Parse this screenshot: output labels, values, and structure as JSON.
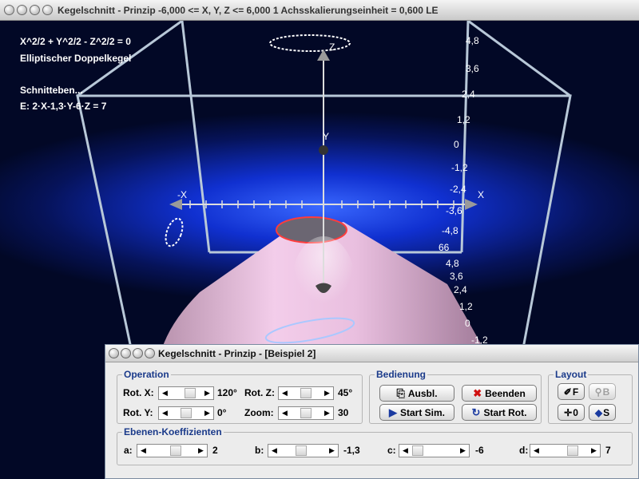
{
  "main_window": {
    "title": "Kegelschnitt - Prinzip   -6,000 <= X, Y, Z <= 6,000    1 Achsskalierungseinheit = 0,600 LE"
  },
  "scene": {
    "equation": "X^2/2 + Y^2/2 - Z^2/2 = 0",
    "shape_name": "Elliptischer Doppelkegel",
    "plane_heading": "Schnitteben...",
    "plane_equation": "E: 2·X-1,3·Y-6·Z = 7",
    "axis_labels": {
      "x_pos": "X",
      "x_neg": "-X",
      "y": "Y",
      "z": "Z"
    },
    "scale_upper": [
      "4,8",
      "3,6",
      "2,4",
      "1,2",
      "0",
      "-1,2",
      "-2,4",
      "-3,6",
      "-4,8"
    ],
    "scale_lower_partial": "66",
    "scale_lower": [
      "4,8",
      "3,6",
      "2,4",
      "1,2",
      "0",
      "-1,2"
    ],
    "colors": {
      "background": "#06135a",
      "cone": "#f2c6e8",
      "section": "#ff4040"
    }
  },
  "dialog": {
    "title": "Kegelschnitt - Prinzip - [Beispiel 2]",
    "operation": {
      "label": "Operation",
      "rot_x_label": "Rot. X:",
      "rot_x_value": "120°",
      "rot_x_pos": 0.7,
      "rot_y_label": "Rot. Y:",
      "rot_y_value": "0°",
      "rot_y_pos": 0.5,
      "rot_z_label": "Rot. Z:",
      "rot_z_value": "45°",
      "rot_z_pos": 0.5,
      "zoom_label": "Zoom:",
      "zoom_value": "30",
      "zoom_pos": 0.5
    },
    "bedienung": {
      "label": "Bedienung",
      "ausbl": "Ausbl.",
      "beenden": "Beenden",
      "start_sim": "Start Sim.",
      "start_rot": "Start Rot."
    },
    "layout": {
      "label": "Layout",
      "btn_f": "F",
      "btn_b": "B",
      "btn_0": "0",
      "btn_s": "S"
    },
    "koeffizienten": {
      "label": "Ebenen-Koeffizienten",
      "a_label": "a:",
      "a_value": "2",
      "a_pos": 0.6,
      "b_label": "b:",
      "b_value": "-1,3",
      "b_pos": 0.45,
      "c_label": "c:",
      "c_value": "-6",
      "c_pos": 0.05,
      "d_label": "d:",
      "d_value": "7",
      "d_pos": 0.7
    }
  }
}
